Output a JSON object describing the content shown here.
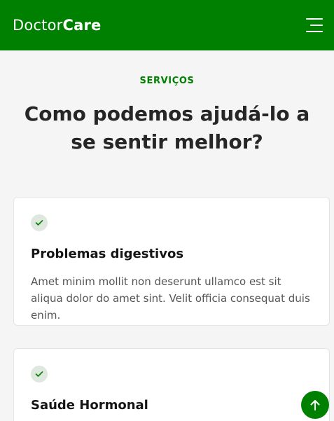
{
  "header": {
    "logo_light": "Doctor",
    "logo_bold": "Care",
    "menu_icon": "hamburger-icon",
    "background": "#008000"
  },
  "section": {
    "eyebrow": "SERVIÇOS",
    "title": "Como podemos ajudá-lo a se sentir melhor?"
  },
  "cards": [
    {
      "icon": "check-icon",
      "title": "Problemas digestivos",
      "text": "Amet minim mollit non deserunt ullamco est sit aliqua dolor do amet sint. Velit officia consequat duis enim."
    },
    {
      "icon": "check-icon",
      "title": "Saúde Hormonal"
    }
  ],
  "back_to_top": {
    "icon": "arrow-up-icon"
  },
  "colors": {
    "accent": "#008000",
    "page_background": "#f4f5f4",
    "check_background": "#dfe8df"
  }
}
